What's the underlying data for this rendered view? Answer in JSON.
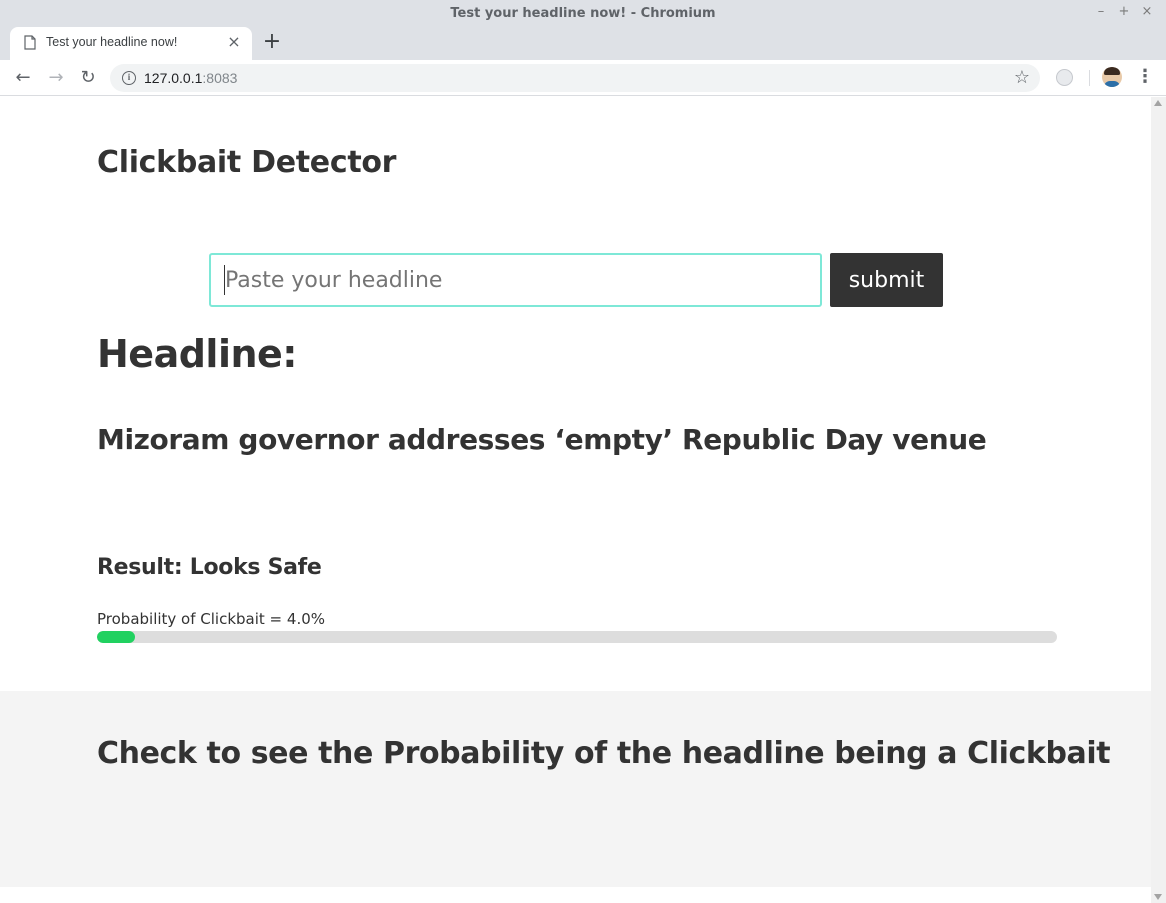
{
  "window": {
    "title": "Test your headline now! - Chromium",
    "controls": {
      "minimize": "–",
      "maximize": "+",
      "close": "×"
    }
  },
  "tab": {
    "title": "Test your headline now!",
    "close": "×",
    "new_tab": "+"
  },
  "toolbar": {
    "back": "←",
    "forward": "→",
    "reload": "↻",
    "url_host": "127.0.0.1",
    "url_port": ":8083",
    "star": "☆",
    "menu": "⋮"
  },
  "page": {
    "app_title": "Clickbait Detector",
    "input_placeholder": "Paste your headline",
    "input_value": "",
    "submit_label": "submit",
    "headline_label": "Headline:",
    "headline_text": "Mizoram governor addresses ‘empty’ Republic Day venue",
    "result_text": "Result: Looks Safe",
    "probability_text": "Probability of Clickbait = 4.0%",
    "probability_value": 0.04,
    "footer_text": "Check to see the Probability of the headline being a Clickbait"
  },
  "colors": {
    "progress_fill": "#21d160",
    "progress_track": "#dddddd",
    "input_border": "#7ee8d7",
    "button_bg": "#333333",
    "footer_bg": "#f4f4f4"
  }
}
